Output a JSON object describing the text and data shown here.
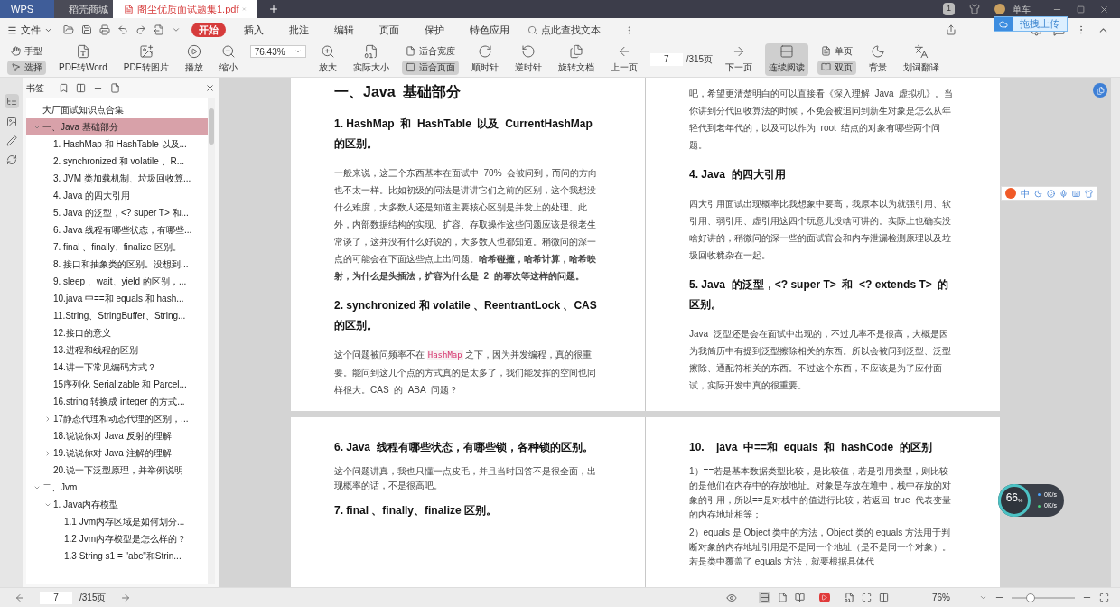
{
  "tabs": [
    {
      "label": "WPS",
      "kind": "brand",
      "selected": false
    },
    {
      "label": "稻壳商城",
      "kind": "store",
      "selected": false
    },
    {
      "label": "阁尘优质面试题集1.pdf",
      "kind": "doc",
      "selected": true
    }
  ],
  "account": {
    "badge": "1",
    "name": "单车"
  },
  "menu": {
    "file": "文件",
    "items": [
      {
        "label": "开始",
        "selected": true
      },
      {
        "label": "插入",
        "selected": false
      },
      {
        "label": "批注",
        "selected": false
      },
      {
        "label": "编辑",
        "selected": false
      },
      {
        "label": "页面",
        "selected": false
      },
      {
        "label": "保护",
        "selected": false
      },
      {
        "label": "特色应用",
        "selected": false
      }
    ],
    "search_placeholder": "点此查找文本"
  },
  "upload_tooltip": "拖拽上传",
  "toolbar": [
    {
      "kind": "pair",
      "items": [
        {
          "label": "手型",
          "selected": false
        },
        {
          "label": "选择",
          "selected": true
        }
      ]
    },
    {
      "kind": "big",
      "label": "PDF转Word",
      "selected": false
    },
    {
      "kind": "big",
      "label": "PDF转图片",
      "selected": false
    },
    {
      "kind": "big",
      "label": "播放",
      "selected": false
    },
    {
      "kind": "big",
      "label": "缩小",
      "selected": false
    },
    {
      "kind": "zoom",
      "value": "76.43%"
    },
    {
      "kind": "big",
      "label": "放大",
      "selected": false
    },
    {
      "kind": "big",
      "label": "实际大小",
      "selected": false
    },
    {
      "kind": "pair",
      "items": [
        {
          "label": "适合宽度",
          "selected": false
        },
        {
          "label": "适合页面",
          "selected": true
        }
      ]
    },
    {
      "kind": "big",
      "label": "顺时针",
      "selected": false
    },
    {
      "kind": "big",
      "label": "逆时针",
      "selected": false
    },
    {
      "kind": "big",
      "label": "旋转文档",
      "selected": false
    },
    {
      "kind": "big",
      "label": "上一页",
      "selected": false
    },
    {
      "kind": "page",
      "value": "7",
      "total": "/315页"
    },
    {
      "kind": "big",
      "label": "下一页",
      "selected": false
    },
    {
      "kind": "big",
      "label": "连续阅读",
      "selected": true
    },
    {
      "kind": "pair",
      "items": [
        {
          "label": "单页",
          "selected": false
        },
        {
          "label": "双页",
          "selected": true
        }
      ]
    },
    {
      "kind": "big",
      "label": "背景",
      "selected": false
    },
    {
      "kind": "big",
      "label": "划词翻译",
      "selected": false
    }
  ],
  "sidebar": {
    "title": "书签",
    "items": [
      {
        "label": "大厂面试知识点合集",
        "selected": false
      },
      {
        "label": "一、Java 基础部分",
        "selected": true,
        "expanded": true,
        "children": [
          {
            "label": "1. HashMap 和 HashTable 以及...",
            "selected": false
          },
          {
            "label": "2. synchronized 和 volatile 、R...",
            "selected": false
          },
          {
            "label": "3. JVM 类加载机制、垃圾回收算...",
            "selected": false
          },
          {
            "label": "4. Java 的四大引用",
            "selected": false
          },
          {
            "label": "5. Java 的泛型，<? super T> 和...",
            "selected": false
          },
          {
            "label": "6. Java 线程有哪些状态，有哪些...",
            "selected": false
          },
          {
            "label": "7. final 、finally、finalize 区别。",
            "selected": false
          },
          {
            "label": "8. 接口和抽象类的区别。没想到...",
            "selected": false
          },
          {
            "label": "9. sleep 、wait、yield 的区别，...",
            "selected": false
          },
          {
            "label": "10.java 中==和 equals 和 hash...",
            "selected": false
          },
          {
            "label": "11.String、StringBuffer、String...",
            "selected": false
          },
          {
            "label": "12.接口的意义",
            "selected": false
          },
          {
            "label": "13.进程和线程的区别",
            "selected": false
          },
          {
            "label": "14.讲一下常见编码方式？",
            "selected": false
          },
          {
            "label": "15序列化 Serializable 和 Parcel...",
            "selected": false
          },
          {
            "label": "16.string 转换成 integer 的方式...",
            "selected": false
          },
          {
            "label": "17静态代理和动态代理的区别，...",
            "selected": false,
            "expanded": false
          },
          {
            "label": "18.说说你对 Java 反射的理解",
            "selected": false
          },
          {
            "label": "19.说说你对 Java 注解的理解",
            "selected": false,
            "expanded": false
          },
          {
            "label": "20.说一下泛型原理，并举例说明",
            "selected": false
          }
        ]
      },
      {
        "label": "二、Jvm",
        "selected": false,
        "expanded": true,
        "children": [
          {
            "label": "1. Java内存模型",
            "selected": false,
            "expanded": true,
            "children": [
              {
                "label": "1.1 Jvm内存区域是如何划分...",
                "selected": false
              },
              {
                "label": "1.2 Jvm内存模型是怎么样的？",
                "selected": false
              },
              {
                "label": "1.3 String s1 = \"abc\"和Strin...",
                "selected": false
              }
            ]
          }
        ]
      }
    ]
  },
  "pages": [
    {
      "blocks": [
        {
          "kind": "h1",
          "text": "一、Java  基础部分"
        },
        {
          "kind": "h2",
          "text": "1. HashMap  和  HashTable  以及  CurrentHashMap  的区别。"
        },
        {
          "kind": "p",
          "text": "一般来说，这三个东西基本在面试中  70%  会被问到，而问的方向也不太一样。比如初级的问法是讲讲它们之前的区别，这个我想没什么难度，大多数人还是知道主要核心区别是并发上的处理。此外，内部数据结构的实现、扩容、存取操作这些问题应该是很老生常谈了，这并没有什么好说的，大多数人也都知道。稍微问的深一点的可能会在下面这些点上出问题。**哈希碰撞，哈希计算，哈希映射，为什么是头插法，扩容为什么是  2  的幂次等这样的问题。**"
        },
        {
          "kind": "h2",
          "text": "2. synchronized 和 volatile 、ReentrantLock 、CAS  的区别。"
        },
        {
          "kind": "p",
          "segments": [
            {
              "kind": "text",
              "text": "这个问题被问频率不在 "
            },
            {
              "kind": "code",
              "text": "HashMap"
            },
            {
              "kind": "text",
              "text": " 之下，因为并发编程，真的很重要。能问到这几个点的方式真的是太多了，我们能发挥的空间也同样很大。CAS  的  ABA  问题？"
            }
          ]
        }
      ]
    },
    {
      "blocks": [
        {
          "kind": "p",
          "text": "吧，希望更清楚明白的可以直接看《深入理解  Java  虚拟机》。当你讲到分代回收算法的时候，不免会被追问到新生对象是怎么从年轻代到老年代的，以及可以作为  root  结点的对象有哪些两个问题。"
        },
        {
          "kind": "h2",
          "text": "4. Java  的四大引用"
        },
        {
          "kind": "p",
          "text": "四大引用面试出现概率比我想象中要高，我原本以为就强引用、软引用、弱引用、虚引用这四个玩意儿没啥可讲的。实际上也确实没啥好讲的，稍微问的深一些的面试官会和内存泄漏检测原理以及垃圾回收糅杂在一起。"
        },
        {
          "kind": "h2",
          "text": "5. Java  的泛型，<? super T>  和  <? extends T>  的区别。"
        },
        {
          "kind": "p",
          "text": "Java  泛型还是会在面试中出现的，不过几率不是很高，大概是因为我简历中有提到泛型擦除相关的东西。所以会被问到泛型、泛型擦除、通配符相关的东西。不过这个东西，不应该是为了应付面试，实际开发中真的很重要。"
        }
      ]
    },
    {
      "blocks": [
        {
          "kind": "h2",
          "text": "6. Java  线程有哪些状态，有哪些锁，各种锁的区别。"
        },
        {
          "kind": "p",
          "text": "这个问题讲真，我也只懂一点皮毛，并且当时回答不是很全面，出现概率的话，不是很高吧。"
        },
        {
          "kind": "h2",
          "text": "7. final 、finally、finalize 区别。"
        }
      ]
    },
    {
      "blocks": [
        {
          "kind": "h2",
          "text": "10.    java  中==和  equals  和  hashCode  的区别"
        },
        {
          "kind": "p",
          "text": "1）==若是基本数据类型比较，是比较值，若是引用类型，则比较的是他们在内存中的存放地址。对象是存放在堆中，栈中存放的对象的引用，所以==是对栈中的值进行比较，若返回  true  代表变量的内存地址相等；"
        },
        {
          "kind": "p",
          "text": "2）equals 是 Object 类中的方法，Object 类的 equals 方法用于判断对象的内存地址引用是不是同一个地址（是不是同一个对象）。若是类中覆盖了 equals 方法，就要根据具体代"
        }
      ]
    }
  ],
  "status": {
    "page": "7",
    "total": "/315页",
    "zoom": "76%",
    "zoom_slider": {
      "level": 0.3
    }
  },
  "speed_meter": {
    "percent": "66",
    "unit": "%",
    "upload": "0K/s",
    "download": "0K/s"
  },
  "ime": {
    "mode": "中"
  }
}
